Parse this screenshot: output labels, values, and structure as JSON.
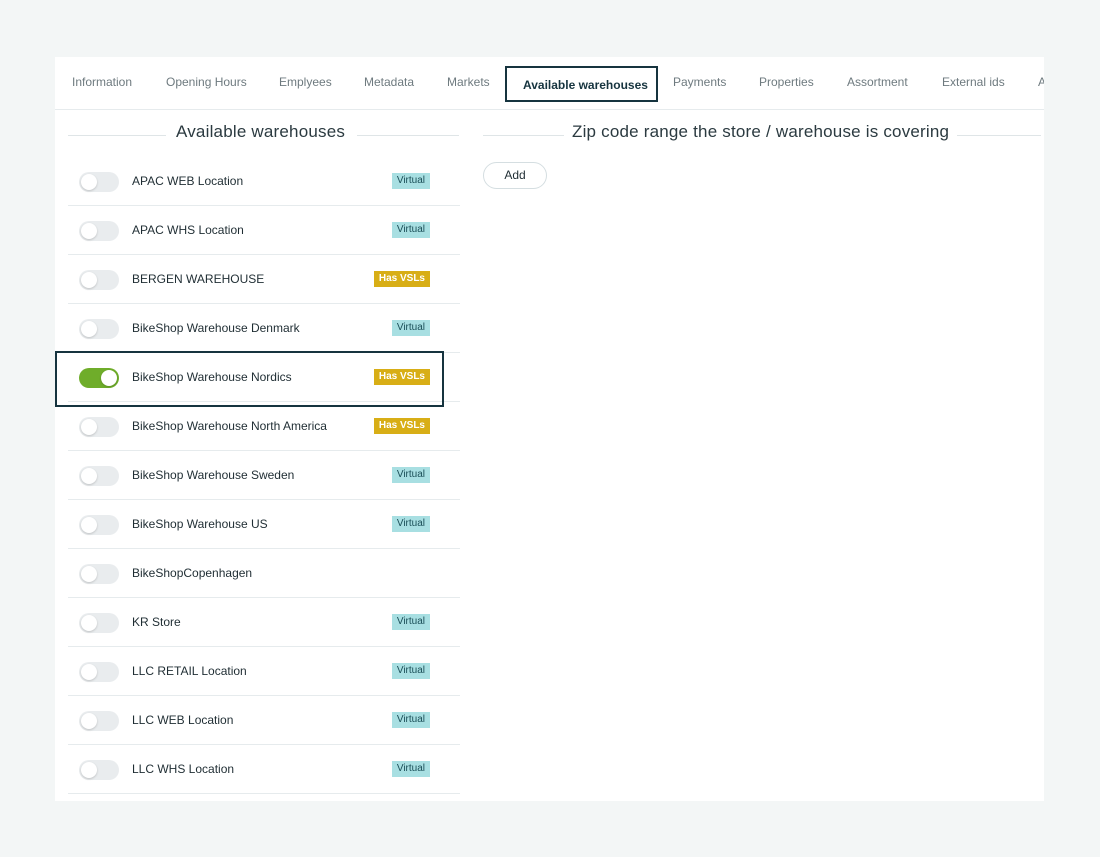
{
  "tabs": [
    {
      "label": "Information"
    },
    {
      "label": "Opening Hours"
    },
    {
      "label": "Emplyees"
    },
    {
      "label": "Metadata"
    },
    {
      "label": "Markets"
    },
    {
      "label": "Available warehouses"
    },
    {
      "label": "Payments"
    },
    {
      "label": "Properties"
    },
    {
      "label": "Assortment"
    },
    {
      "label": "External ids"
    },
    {
      "label": "A"
    }
  ],
  "active_tab": "Available warehouses",
  "left_section": {
    "title": "Available warehouses"
  },
  "right_section": {
    "title": "Zip code range the store / warehouse is covering",
    "add_label": "Add"
  },
  "warehouses": [
    {
      "name": "APAC WEB Location",
      "enabled": false,
      "badge": "Virtual"
    },
    {
      "name": "APAC WHS Location",
      "enabled": false,
      "badge": "Virtual"
    },
    {
      "name": "BERGEN WAREHOUSE",
      "enabled": false,
      "badge": "Has VSLs"
    },
    {
      "name": "BikeShop Warehouse Denmark",
      "enabled": false,
      "badge": "Virtual"
    },
    {
      "name": "BikeShop Warehouse Nordics",
      "enabled": true,
      "badge": "Has VSLs"
    },
    {
      "name": "BikeShop Warehouse North America",
      "enabled": false,
      "badge": "Has VSLs"
    },
    {
      "name": "BikeShop Warehouse Sweden",
      "enabled": false,
      "badge": "Virtual"
    },
    {
      "name": "BikeShop Warehouse US",
      "enabled": false,
      "badge": "Virtual"
    },
    {
      "name": "BikeShopCopenhagen",
      "enabled": false,
      "badge": ""
    },
    {
      "name": "KR Store",
      "enabled": false,
      "badge": "Virtual"
    },
    {
      "name": "LLC RETAIL Location",
      "enabled": false,
      "badge": "Virtual"
    },
    {
      "name": "LLC WEB Location",
      "enabled": false,
      "badge": "Virtual"
    },
    {
      "name": "LLC WHS Location",
      "enabled": false,
      "badge": "Virtual"
    }
  ],
  "colors": {
    "toggle_on": "#6fad2a",
    "badge_virtual": "#a8dfe2",
    "badge_has_vsls": "#d8ae16",
    "active_border": "#16343f"
  }
}
